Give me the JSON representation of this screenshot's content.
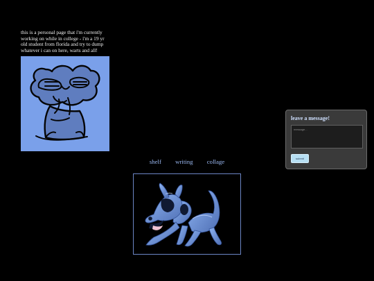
{
  "intro": {
    "text": "this is a personal page that i'm currently working on while in college - i'm a 19 yr old student from florida and try to dump whatever i can on here, warts and all!"
  },
  "avatar": {
    "icon": "doodle-avatar-icon",
    "background_color": "#7aa0ea"
  },
  "nav": {
    "items": [
      {
        "label": "shelf"
      },
      {
        "label": "writing"
      },
      {
        "label": "collage"
      }
    ],
    "link_color": "#9bb9f3"
  },
  "photo": {
    "icon": "dog-photo-icon",
    "border_color": "#6d87c7"
  },
  "message": {
    "title": "leave a message!",
    "placeholder": "message...",
    "submit_label": "submit"
  }
}
